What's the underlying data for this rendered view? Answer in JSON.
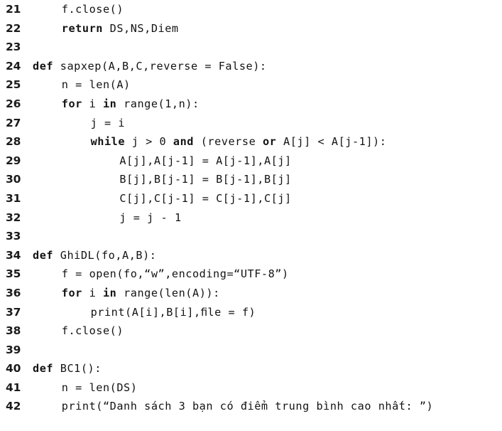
{
  "document": {
    "type": "python-code-listing",
    "language": "Python",
    "background_color": "#ffffff",
    "text_color": "#131313",
    "first_line_number": 21,
    "last_line_number": 42,
    "total_lines": 22
  },
  "code": {
    "lines": [
      {
        "number": "21",
        "indent": 4,
        "text": "f.close()",
        "keyword": ""
      },
      {
        "number": "22",
        "indent": 4,
        "text": "return DS,NS,Diem",
        "keyword": "return"
      },
      {
        "number": "23",
        "indent": 0,
        "text": "",
        "keyword": ""
      },
      {
        "number": "24",
        "indent": 0,
        "text": "def sapxep(A,B,C,reverse = False):",
        "keyword": "def"
      },
      {
        "number": "25",
        "indent": 4,
        "text": "n = len(A)",
        "keyword": ""
      },
      {
        "number": "26",
        "indent": 4,
        "text": "for i in range(1,n):",
        "keyword": "for in"
      },
      {
        "number": "27",
        "indent": 8,
        "text": "j = i",
        "keyword": ""
      },
      {
        "number": "28",
        "indent": 8,
        "text": "while j > 0 and (reverse or A[j] < A[j-1]):",
        "keyword": "while and or"
      },
      {
        "number": "29",
        "indent": 12,
        "text": "A[j],A[j-1] = A[j-1],A[j]",
        "keyword": ""
      },
      {
        "number": "30",
        "indent": 12,
        "text": "B[j],B[j-1] = B[j-1],B[j]",
        "keyword": ""
      },
      {
        "number": "31",
        "indent": 12,
        "text": "C[j],C[j-1] = C[j-1],C[j]",
        "keyword": ""
      },
      {
        "number": "32",
        "indent": 12,
        "text": "j = j - 1",
        "keyword": ""
      },
      {
        "number": "33",
        "indent": 0,
        "text": "",
        "keyword": ""
      },
      {
        "number": "34",
        "indent": 0,
        "text": "def GhiDL(fo,A,B):",
        "keyword": "def"
      },
      {
        "number": "35",
        "indent": 4,
        "text": "f = open(fo,“w”,encoding=“UTF-8”)",
        "keyword": ""
      },
      {
        "number": "36",
        "indent": 4,
        "text": "for i in range(len(A)):",
        "keyword": "for in"
      },
      {
        "number": "37",
        "indent": 8,
        "text": "print(A[i],B[i],ﬁle = f)",
        "keyword": ""
      },
      {
        "number": "38",
        "indent": 4,
        "text": "f.close()",
        "keyword": ""
      },
      {
        "number": "39",
        "indent": 0,
        "text": "",
        "keyword": ""
      },
      {
        "number": "40",
        "indent": 0,
        "text": "def BC1():",
        "keyword": "def"
      },
      {
        "number": "41",
        "indent": 4,
        "text": "n = len(DS)",
        "keyword": ""
      },
      {
        "number": "42",
        "indent": 4,
        "text": "print(“Danh sách 3 bạn có điểm trung bình cao nhất: ”)",
        "keyword": ""
      }
    ],
    "html_segments": [
      [
        {
          "t": "f.close()",
          "b": false
        }
      ],
      [
        {
          "t": "return",
          "b": true
        },
        {
          "t": " DS,NS,Diem",
          "b": false
        }
      ],
      [],
      [
        {
          "t": "def",
          "b": true
        },
        {
          "t": " sapxep(A,B,C,reverse = False):",
          "b": false
        }
      ],
      [
        {
          "t": "n = len(A)",
          "b": false
        }
      ],
      [
        {
          "t": "for",
          "b": true
        },
        {
          "t": " i ",
          "b": false
        },
        {
          "t": "in",
          "b": true
        },
        {
          "t": " range(1,n):",
          "b": false
        }
      ],
      [
        {
          "t": "j = i",
          "b": false
        }
      ],
      [
        {
          "t": "while",
          "b": true
        },
        {
          "t": " j > 0 ",
          "b": false
        },
        {
          "t": "and",
          "b": true
        },
        {
          "t": " (reverse ",
          "b": false
        },
        {
          "t": "or",
          "b": true
        },
        {
          "t": " A[j] < A[j-1]):",
          "b": false
        }
      ],
      [
        {
          "t": "A[j],A[j-1] = A[j-1],A[j]",
          "b": false
        }
      ],
      [
        {
          "t": "B[j],B[j-1] = B[j-1],B[j]",
          "b": false
        }
      ],
      [
        {
          "t": "C[j],C[j-1] = C[j-1],C[j]",
          "b": false
        }
      ],
      [
        {
          "t": "j = j - 1",
          "b": false
        }
      ],
      [],
      [
        {
          "t": "def",
          "b": true
        },
        {
          "t": " GhiDL(fo,A,B):",
          "b": false
        }
      ],
      [
        {
          "t": "f = open(fo,“w”,encoding=“UTF-8”)",
          "b": false
        }
      ],
      [
        {
          "t": "for",
          "b": true
        },
        {
          "t": " i ",
          "b": false
        },
        {
          "t": "in",
          "b": true
        },
        {
          "t": " range(len(A)):",
          "b": false
        }
      ],
      [
        {
          "t": "print(A[i],B[i],ﬁle = f)",
          "b": false
        }
      ],
      [
        {
          "t": "f.close()",
          "b": false
        }
      ],
      [],
      [
        {
          "t": "def",
          "b": true
        },
        {
          "t": " BC1():",
          "b": false
        }
      ],
      [
        {
          "t": "n = len(DS)",
          "b": false
        }
      ],
      [
        {
          "t": "print(“Danh sách 3 bạn có điểm trung bình cao nhất: ”)",
          "b": false
        }
      ]
    ]
  }
}
